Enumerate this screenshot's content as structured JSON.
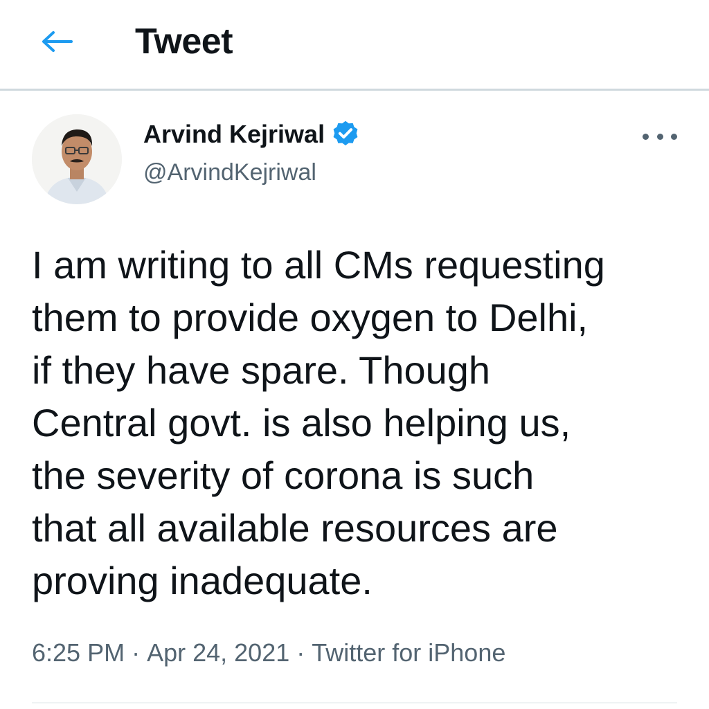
{
  "header": {
    "title": "Tweet",
    "back_icon": "arrow-left-icon",
    "accent_color": "#1d9bf0"
  },
  "author": {
    "name": "Arvind Kejriwal",
    "handle": "@ArvindKejriwal",
    "verified": true,
    "verified_icon": "verified-badge-icon",
    "verified_color": "#1d9bf0"
  },
  "tweet": {
    "text": "I am writing to all CMs requesting\nthem to provide oxygen to Delhi,\nif they have spare. Though\nCentral govt. is also helping us,\nthe severity of corona is such\nthat all available resources are\nproving inadequate.",
    "time": "6:25 PM",
    "date": "Apr 24, 2021",
    "separator": "·",
    "source": "Twitter for iPhone"
  },
  "more_icon": "more-horizontal-icon"
}
